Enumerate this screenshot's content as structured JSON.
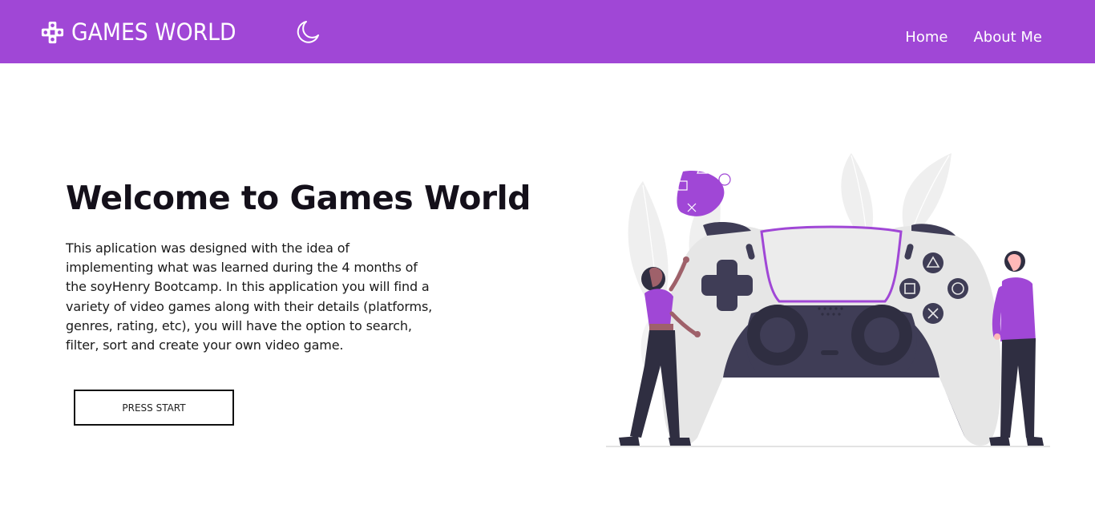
{
  "brand": {
    "name": "GAMES WORLD",
    "logo_icon": "gamepad-icon"
  },
  "header": {
    "theme_toggle_icon": "moon-icon",
    "nav": [
      {
        "label": "Home"
      },
      {
        "label": "About Me"
      }
    ]
  },
  "hero": {
    "title": "Welcome to Games World",
    "description": "This aplication was designed with the idea of implementing what was learned during the 4 months of the soyHenry Bootcamp. In this application you will find a variety of video games along with their details (platforms, genres, rating, etc), you will have the option to search, filter, sort and create your own video game.",
    "cta_label": "PRESS START"
  },
  "colors": {
    "accent": "#a047d6",
    "dark": "#3f3d56",
    "text": "#14101a"
  }
}
